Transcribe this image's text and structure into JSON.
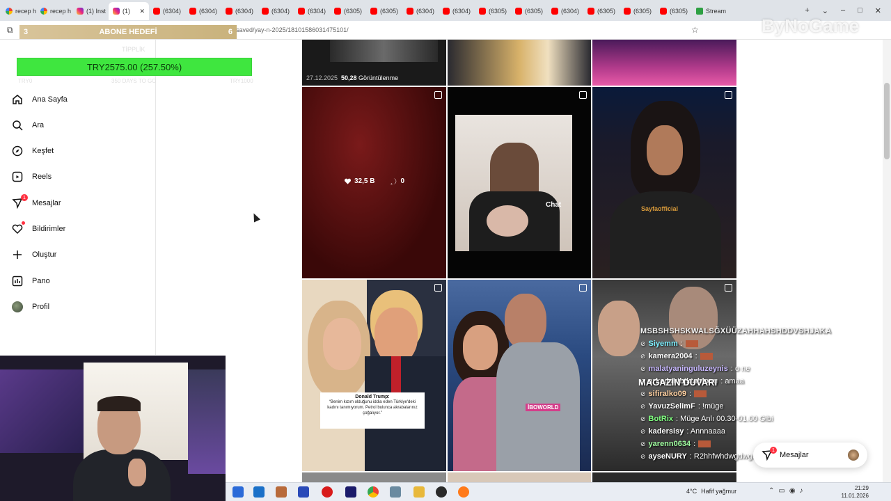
{
  "browser": {
    "tabs": [
      {
        "label": "recep h",
        "icon": "google-icon",
        "active": false
      },
      {
        "label": "recep h",
        "icon": "google-icon",
        "active": false
      },
      {
        "label": "(1) Inst",
        "icon": "instagram-icon",
        "active": false
      },
      {
        "label": "(1)",
        "icon": "instagram-icon",
        "active": true
      },
      {
        "label": "(6304)",
        "icon": "youtube-icon",
        "active": false
      },
      {
        "label": "(6304)",
        "icon": "youtube-icon",
        "active": false
      },
      {
        "label": "(6304)",
        "icon": "youtube-icon",
        "active": false
      },
      {
        "label": "(6304)",
        "icon": "youtube-icon",
        "active": false
      },
      {
        "label": "(6304)",
        "icon": "youtube-icon",
        "active": false
      },
      {
        "label": "(6305)",
        "icon": "youtube-icon",
        "active": false
      },
      {
        "label": "(6305)",
        "icon": "youtube-icon",
        "active": false
      },
      {
        "label": "(6304)",
        "icon": "youtube-icon",
        "active": false
      },
      {
        "label": "(6304)",
        "icon": "youtube-icon",
        "active": false
      },
      {
        "label": "(6305)",
        "icon": "youtube-icon",
        "active": false
      },
      {
        "label": "(6305)",
        "icon": "youtube-icon",
        "active": false
      },
      {
        "label": "(6304)",
        "icon": "youtube-icon",
        "active": false
      },
      {
        "label": "(6305)",
        "icon": "youtube-icon",
        "active": false
      },
      {
        "label": "(6305)",
        "icon": "youtube-icon",
        "active": false
      },
      {
        "label": "(6305)",
        "icon": "youtube-icon",
        "active": false
      },
      {
        "label": "Stream",
        "icon": "stream-icon",
        "active": false
      }
    ],
    "url": "www.instagram.com/tame.../saved/yay-n-2025/18101586031475101/",
    "new_tab": "+",
    "tab_menu": "⌄",
    "window_minimize": "–",
    "window_maximize": "□",
    "window_close": "✕"
  },
  "goal_overlay": {
    "title": "ABONE HEDEFİ",
    "left_count": "3",
    "right_count": "6",
    "label": "TİPPLİK",
    "amount_text": "TRY2575.00 (257.50%)",
    "progress_fraction": 1.0,
    "bottom_left": "TRY0",
    "bottom_mid": "350 DAYS TO GO",
    "bottom_right": "TRY1000"
  },
  "sidebar": {
    "items": [
      {
        "label": "Ana Sayfa",
        "icon": "home-icon"
      },
      {
        "label": "Ara",
        "icon": "search-icon"
      },
      {
        "label": "Keşfet",
        "icon": "compass-icon"
      },
      {
        "label": "Reels",
        "icon": "reels-icon"
      },
      {
        "label": "Mesajlar",
        "icon": "messenger-icon",
        "badge": "1"
      },
      {
        "label": "Bildirimler",
        "icon": "heart-icon"
      },
      {
        "label": "Oluştur",
        "icon": "plus-icon"
      },
      {
        "label": "Pano",
        "icon": "dashboard-icon"
      },
      {
        "label": "Profil",
        "icon": "avatar"
      }
    ]
  },
  "grid": {
    "top_date": "27.12.2025",
    "top_views": "50,28",
    "top_views_label": "Görüntülenme",
    "hover_likes": "32,5 B",
    "hover_comments": "0",
    "chat_tile_label": "Chat",
    "sayfa_watermark": "Sayfaofficial",
    "caption_title": "Donald Trump:",
    "caption_body": "“Benim kızım olduğunu iddia eden Türkiye'deki kadını tanımıyorum. Petrol bulunca akrabalarınız çoğalıyor.”",
    "sticker_label": "İBOWORLD",
    "magazin_label": "MAGAZİN DUVARI"
  },
  "chat": {
    "title": "MSBSHSHSKWALSĞXÜÜZAHHAHSHDDVSHJAKA",
    "messages": [
      {
        "user": "Siyemm",
        "text": ":",
        "color": "#7df0ff",
        "emote": true
      },
      {
        "user": "kamera2004",
        "text": ":",
        "color": "#ffffff",
        "emote": true
      },
      {
        "user": "malatyaninguluzeynis",
        "text": ": o ne",
        "color": "#c8b8ff",
        "emote": false
      },
      {
        "user": "arkadakibjktablosu",
        "text": ": amaa",
        "color": "#ffffff",
        "emote": false
      },
      {
        "user": "sifiralko09",
        "text": ":",
        "color": "#ffd0a0",
        "emote": true
      },
      {
        "user": "YavuzSelimF",
        "text": ": !müge",
        "color": "#ffffff",
        "emote": false
      },
      {
        "user": "BotRix",
        "text": ": Müge Anlı 00.30-01.00 Gibi",
        "color": "#80ff80",
        "emote": false
      },
      {
        "user": "kadersisy",
        "text": ": Annnaaaa",
        "color": "#ffffff",
        "emote": false
      },
      {
        "user": "yarenn0634",
        "text": ":",
        "color": "#a0ffa0",
        "emote": true
      },
      {
        "user": "ayseNURY",
        "text": ": R2hhfwhdwgdwgwrgwrhwgrwhrw",
        "color": "#ffffff",
        "emote": false
      }
    ]
  },
  "messages_pill": {
    "label": "Mesajlar",
    "badge": "1"
  },
  "taskbar": {
    "temperature": "4°C",
    "weather": "Hafif yağmur",
    "time": "21:29",
    "date": "11.01.2026"
  },
  "watermark": "ByNoGame",
  "colors": {
    "goal_green": "#3fe63f",
    "notification_red": "#ff3040",
    "instagram_bg": "#ffffff"
  }
}
